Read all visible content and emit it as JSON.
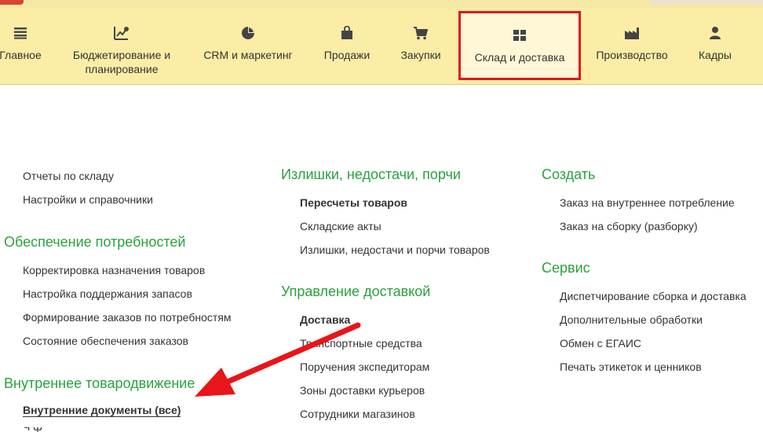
{
  "sections": {
    "items": [
      {
        "label": "Главное",
        "icon": "hamburger-icon"
      },
      {
        "label": "Бюджетирование и планирование",
        "icon": "budget-icon"
      },
      {
        "label": "CRM и маркетинг",
        "icon": "pie-chart-icon"
      },
      {
        "label": "Продажи",
        "icon": "shopping-bag-icon"
      },
      {
        "label": "Закупки",
        "icon": "shopping-cart-icon"
      },
      {
        "label": "Склад и доставка",
        "icon": "warehouse-icon"
      },
      {
        "label": "Производство",
        "icon": "factory-icon"
      },
      {
        "label": "Кадры",
        "icon": "person-icon"
      }
    ],
    "active": "Склад и доставка",
    "highlight_color": "#e3161b",
    "panel_color": "#fbeda6"
  },
  "col1": {
    "links": [
      "Отчеты по складу",
      "Настройки и справочники"
    ],
    "group1": {
      "title": "Обеспечение потребностей",
      "items": [
        "Корректировка назначения товаров",
        "Настройка поддержания запасов",
        "Формирование заказов по потребностям",
        "Состояние обеспечения заказов"
      ]
    },
    "group2": {
      "title": "Внутреннее товародвижение",
      "items": [
        "Внутренние документы (все)"
      ]
    }
  },
  "col2": {
    "group1": {
      "title": "Излишки, недостачи, порчи",
      "items": [
        "Пересчеты товаров",
        "Складские акты",
        "Излишки, недостачи и порчи товаров"
      ]
    },
    "group2": {
      "title": "Управление доставкой",
      "items": [
        "Доставка",
        "Транспортные средства",
        "Поручения экспедиторам",
        "Зоны доставки курьеров",
        "Сотрудники магазинов"
      ]
    }
  },
  "col3": {
    "group1": {
      "title": "Создать",
      "items": [
        "Заказ на внутреннее потребление",
        "Заказ на сборку (разборку)"
      ]
    },
    "group2": {
      "title": "Сервис",
      "items": [
        "Диспетчирование сборка и доставка",
        "Дополнительные обработки",
        "Обмен с ЕГАИС",
        "Печать этикеток и ценников"
      ]
    }
  },
  "colors": {
    "group_title": "#2aa23c",
    "annotation_arrow": "#e8151b"
  }
}
